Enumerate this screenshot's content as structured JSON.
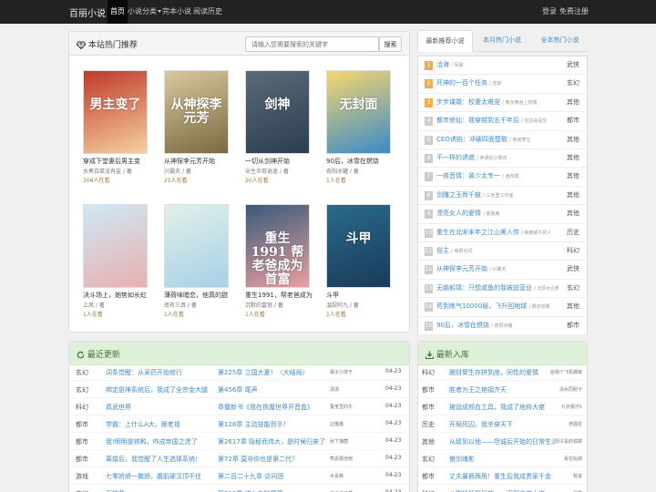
{
  "navbar": {
    "brand": "百丽小说",
    "items": [
      "首页",
      "小说分类",
      "完本小说",
      "阅读历史"
    ],
    "login": "登录",
    "register": "免费注册"
  },
  "hot": {
    "title": "本站热门推荐",
    "search_placeholder": "请输入您需要搜索的关键字",
    "search_button": "搜索",
    "books": [
      {
        "title": "穿成下堂妻后男主变",
        "author": "水煮白菜没有盐 / 著",
        "readers": "306人在看",
        "cover_text": "男主变了",
        "c1": "#c0392b",
        "c2": "#f5d0a0"
      },
      {
        "title": "从神探李元芳开始",
        "author": "兴霸天 / 著",
        "readers": "21人在看",
        "cover_text": "从神探李元芳",
        "c1": "#d8c8a0",
        "c2": "#7a6a40"
      },
      {
        "title": "一切从剑神开始",
        "author": "朵生半荷逍遥 / 著",
        "readers": "20人在看",
        "cover_text": "剑神",
        "c1": "#5a6a78",
        "c2": "#2c3e50"
      },
      {
        "title": "90后，冰雪在燃烧",
        "author": "奇阳冰罐 / 著",
        "readers": "1人在看",
        "cover_text": "无封面",
        "c1": "#f5d76e",
        "c2": "#3a8ac8"
      },
      {
        "title": "决斗场上，她势如长虹",
        "author": "上风 / 著",
        "readers": "1人在看",
        "cover_text": "",
        "c1": "#cfe8f5",
        "c2": "#e8b0b0"
      },
      {
        "title": "薄荷味暗恋，他真的甜",
        "author": "南有三真 / 著",
        "readers": "1人在看",
        "cover_text": "",
        "c1": "#e0f0e8",
        "c2": "#a8d0e8"
      },
      {
        "title": "重生1991，帮老爸成为首富",
        "author": "沉默的富翁 / 著",
        "readers": "1人在看",
        "cover_text": "重生1991 帮老爸成为首富",
        "c1": "#3a5a7a",
        "c2": "#e8a0a0"
      },
      {
        "title": "斗甲",
        "author": "温厨阿九 / 著",
        "readers": "1人在看",
        "cover_text": "斗甲",
        "c1": "#2a6a8a",
        "c2": "#1a3a5a"
      }
    ]
  },
  "rank": {
    "tabs": [
      "最新推荐小说",
      "本月热门小说",
      "全本热门小说"
    ],
    "items": [
      {
        "num": "1",
        "title": "洽海",
        "author": "凤歌",
        "genre": "武侠"
      },
      {
        "num": "2",
        "title": "死神的一百个任务",
        "author": "苦斩",
        "genre": "玄幻"
      },
      {
        "num": "3",
        "title": "步步谋婚：校妻太难宠",
        "author": "黄衣黄逍上玫瑰",
        "genre": "其他"
      },
      {
        "num": "4",
        "title": "都市修仙：我穿越到五千年后",
        "author": "自古会是空",
        "genre": "都市"
      },
      {
        "num": "5",
        "title": "CEO诱陷：冲破四面楚歌",
        "author": "南宫寒玉",
        "genre": "其他"
      },
      {
        "num": "6",
        "title": "不一样的诱惑",
        "author": "卖梁的小菜花",
        "genre": "其他"
      },
      {
        "num": "7",
        "title": "一夜音情：装少太专一",
        "author": "逍布帮",
        "genre": "其他"
      },
      {
        "num": "8",
        "title": "剑雕之玉骨千痕",
        "author": "三色重工作室",
        "genre": "其他"
      },
      {
        "num": "9",
        "title": "漂亮女人的爱情",
        "author": "夏媛美",
        "genre": "其他"
      },
      {
        "num": "10",
        "title": "重生在北宋末年之江山美人传",
        "author": "碗着蜗牛的人",
        "genre": "历史"
      },
      {
        "num": "11",
        "title": "俗主",
        "author": "南阳论词",
        "genre": "科幻"
      },
      {
        "num": "12",
        "title": "从神探李元芳开始",
        "author": "兴霸天",
        "genre": "武侠"
      },
      {
        "num": "13",
        "title": "无脑躬靖：只想咸鱼的我被迫营业",
        "author": "北辰大企鹅",
        "genre": "玄幻"
      },
      {
        "num": "14",
        "title": "苟到练气10000层，飞升回地球",
        "author": "狮衣惊翼",
        "genre": "其他"
      },
      {
        "num": "15",
        "title": "90后，冰雪在燃烧",
        "author": "奇阳冰罐",
        "genre": "都市"
      }
    ]
  },
  "updates": {
    "title": "最近更新",
    "rows": [
      {
        "genre": "玄幻",
        "title": "词条觉醒：从采药开始修行",
        "chapter": "第225章 立国大夏！（大结局）",
        "author": "橘子小饼干",
        "date": "04-23"
      },
      {
        "genre": "玄幻",
        "title": "绑定厨神系统后，我成了全宗金大腿",
        "chapter": "第456章 尾声",
        "author": "潇潇",
        "date": "04-23"
      },
      {
        "genre": "科幻",
        "title": "真武世界",
        "chapter": "章蚕新书《我在铁魔世界开音盒》",
        "author": "蚕茧里的牛",
        "date": "04-23"
      },
      {
        "genre": "都市",
        "title": "学霸：上什么A大，跟老祖",
        "chapter": "第128章 主动技能到手！",
        "author": "边猫猫",
        "date": "04-23"
      },
      {
        "genre": "都市",
        "title": "我!明明是铁鸭，咋成帝国之虎了",
        "chapter": "第2617章 隐秘而伟大，是时候归来了",
        "author": "树下捕菌",
        "date": "04-23"
      },
      {
        "genre": "都市",
        "title": "离婚后，我觉醒了人生选择系统！",
        "chapter": "第72章 莫非你也是第二代？",
        "author": "寒衾展佳雨",
        "date": "04-23"
      },
      {
        "genre": "游戏",
        "title": "七零娇娇一撒娇，腹肌硬汉顶不住",
        "chapter": "第二百二十九章 访问团",
        "author": "木喜薇",
        "date": "04-23"
      },
      {
        "genre": "玄幻",
        "title": "万神鼎",
        "chapter": "第218章 进入血陆魔界",
        "author": "白玉谣子基",
        "date": "04-23"
      }
    ]
  },
  "newbooks": {
    "title": "最新入库",
    "rows": [
      {
        "genre": "科幻",
        "title": "跟财聚生存拼到底，同性的爱情",
        "author": "给我个飞机蝶嫁"
      },
      {
        "genre": "都市",
        "title": "胜者为王之艳福齐天",
        "author": "清水同耐卡"
      },
      {
        "genre": "都市",
        "title": "被迫成频血工具，我成了地府大佬",
        "author": "九天银河1"
      },
      {
        "genre": "历史",
        "title": "开局死囚，我杀穿天下",
        "author": "老骚花"
      },
      {
        "genre": "其他",
        "title": "从敌到以他——坦诚后开始的日常生活",
        "author": "阳子是的铁搞"
      },
      {
        "genre": "玄幻",
        "title": "傲剑魂影",
        "author": "看在始城"
      },
      {
        "genre": "都市",
        "title": "丈夫暴裤两用！重生后我成贵家千金",
        "author": "赃姿"
      },
      {
        "genre": "科幻",
        "title": "八零娇娇娶又辣，一下翻身做大佬",
        "author": "晨霞"
      }
    ]
  }
}
